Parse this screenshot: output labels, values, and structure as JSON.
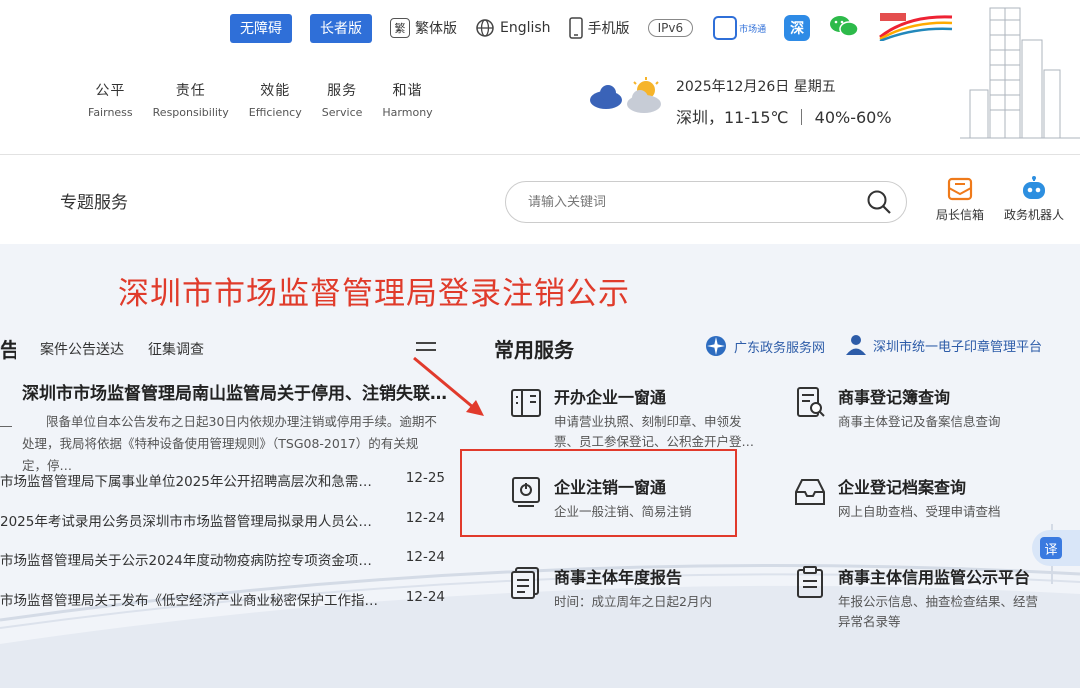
{
  "topbar": {
    "accessible_label": "无障碍",
    "elder_label": "长者版",
    "traditional_label": "繁体版",
    "traditional_glyph": "繁",
    "english_label": "English",
    "mobile_label": "手机版",
    "ipv6_label": "IPv6",
    "shichangtong_label": "市场通",
    "app2_glyph": "深"
  },
  "values": [
    {
      "zh": "公平",
      "en": "Fairness"
    },
    {
      "zh": "责任",
      "en": "Responsibility"
    },
    {
      "zh": "效能",
      "en": "Efficiency"
    },
    {
      "zh": "服务",
      "en": "Service"
    },
    {
      "zh": "和谐",
      "en": "Harmony"
    }
  ],
  "weather": {
    "date": "2025年12月26日 星期五",
    "line": "深圳，11-15℃  ｜ 40%-60%"
  },
  "topic_label": "专题服务",
  "search": {
    "placeholder": "请输入关键词"
  },
  "quick": {
    "mailbox_label": "局长信箱",
    "robot_label": "政务机器人"
  },
  "banner": "深圳市市场监督管理局登录注销公示",
  "left": {
    "cut_title": "告",
    "tabs": [
      "案件公告送达",
      "征集调查"
    ],
    "headline": "深圳市市场监督管理局南山监管局关于停用、注销失联单…",
    "summary": "限备单位自本公告发布之日起30日内依规办理注销或停用手续。逾期不处理，我局将依据《特种设备使用管理规则》（TSG08-2017）的有关规定，停…",
    "news": [
      {
        "title": "市场监督管理局下属事业单位2025年公开招聘高层次和急需紧…",
        "date": "12-25"
      },
      {
        "title": "2025年考试录用公务员深圳市市场监督管理局拟录用人员公示…",
        "date": "12-24"
      },
      {
        "title": "市场监督管理局关于公示2024年度动物疫病防控专项资金项目…",
        "date": "12-24"
      },
      {
        "title": "市场监督管理局关于发布《低空经济产业商业秘密保护工作指…",
        "date": "12-24"
      }
    ]
  },
  "services": {
    "title": "常用服务",
    "link_gd": "广东政务服务网",
    "link_seal": "深圳市统一电子印章管理平台",
    "items": [
      {
        "name": "开办企业一窗通",
        "desc": "申请营业执照、刻制印章、申领发票、员工参保登记、公积金开户登…"
      },
      {
        "name": "商事登记簿查询",
        "desc": "商事主体登记及备案信息查询"
      },
      {
        "name": "企业注销一窗通",
        "desc": "企业一般注销、简易注销"
      },
      {
        "name": "企业登记档案查询",
        "desc": "网上自助查档、受理申请查档"
      },
      {
        "name": "商事主体年度报告",
        "desc": "时间：成立周年之日起2月内"
      },
      {
        "name": "商事主体信用监管公示平台",
        "desc": "年报公示信息、抽查检查结果、经营异常名录等"
      }
    ]
  },
  "translate_glyph": "译",
  "colors": {
    "accent_blue": "#2f6fd8",
    "annotation_red": "#e13a2c",
    "link_blue": "#2d5ca8"
  }
}
